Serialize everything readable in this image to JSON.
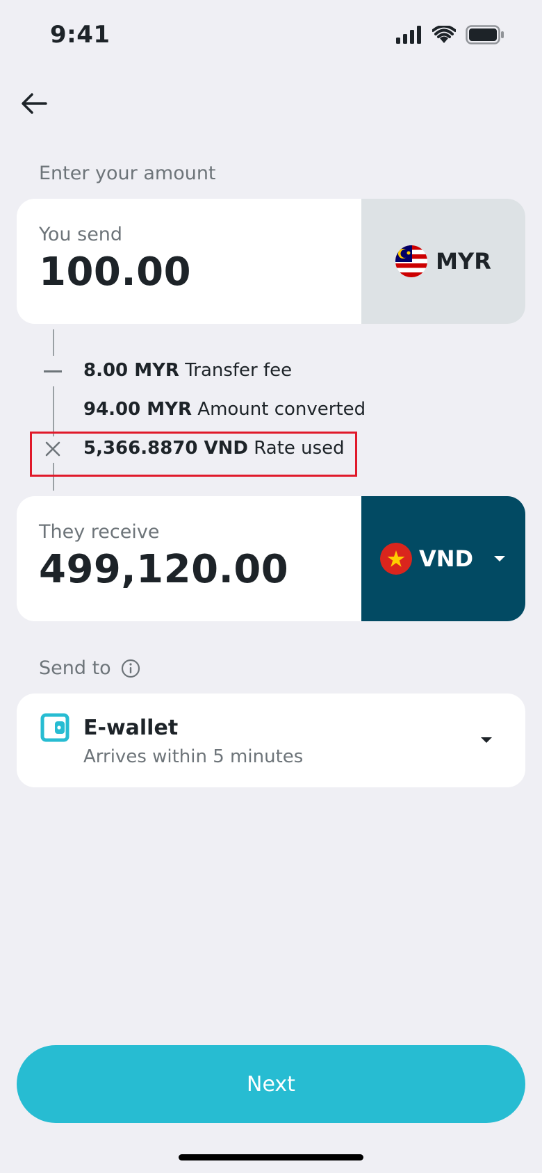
{
  "status_bar": {
    "time": "9:41"
  },
  "header": {
    "section_label": "Enter your amount"
  },
  "send": {
    "caption": "You send",
    "amount": "100.00",
    "currency": "MYR"
  },
  "breakdown": {
    "fee_value": "8.00 MYR",
    "fee_label": "Transfer fee",
    "converted_value": "94.00 MYR",
    "converted_label": "Amount converted",
    "rate_value": "5,366.8870 VND",
    "rate_label": "Rate used"
  },
  "receive": {
    "caption": "They receive",
    "amount": "499,120.00",
    "currency": "VND"
  },
  "send_to": {
    "label": "Send to",
    "method_title": "E-wallet",
    "method_subtitle": "Arrives within 5 minutes"
  },
  "footer": {
    "next_label": "Next"
  },
  "colors": {
    "accent": "#27bcd2",
    "receive_currency_bg": "#024a63",
    "send_currency_bg": "#dde2e5",
    "highlight": "#e0192a"
  }
}
